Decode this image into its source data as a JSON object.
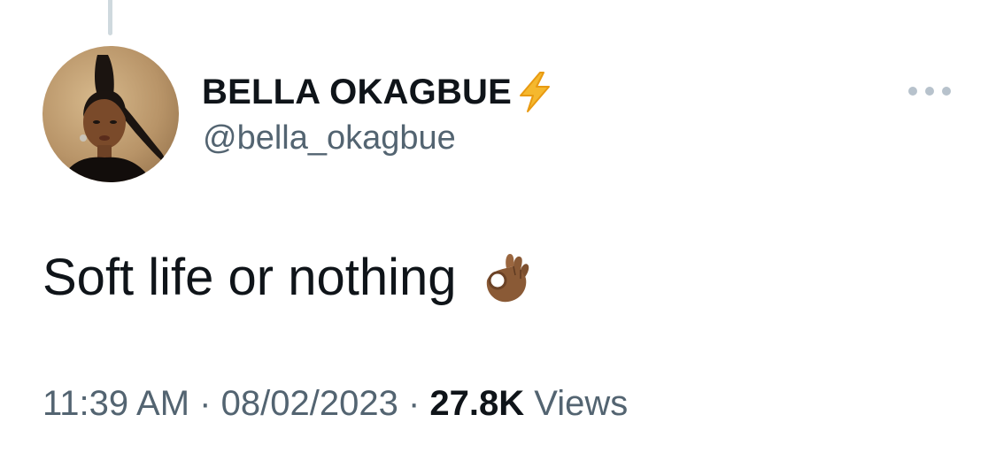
{
  "tweet": {
    "author": {
      "display_name": "BELLA OKAGBUE",
      "handle": "@bella_okagbue",
      "badge_icon": "lightning-bolt-icon",
      "avatar": "profile-photo"
    },
    "text": "Soft life or nothing",
    "emoji_icon": "ok-hand-icon",
    "time": "11:39 AM",
    "separator": "·",
    "date": "08/02/2023",
    "views_count": "27.8K",
    "views_label": "Views",
    "more_icon": "more-options-icon"
  },
  "colors": {
    "text_primary": "#0f1419",
    "text_secondary": "#536471",
    "bolt": "#f5b82e",
    "more_dots": "#b7c2cc",
    "thread_line": "#cfd9de"
  }
}
